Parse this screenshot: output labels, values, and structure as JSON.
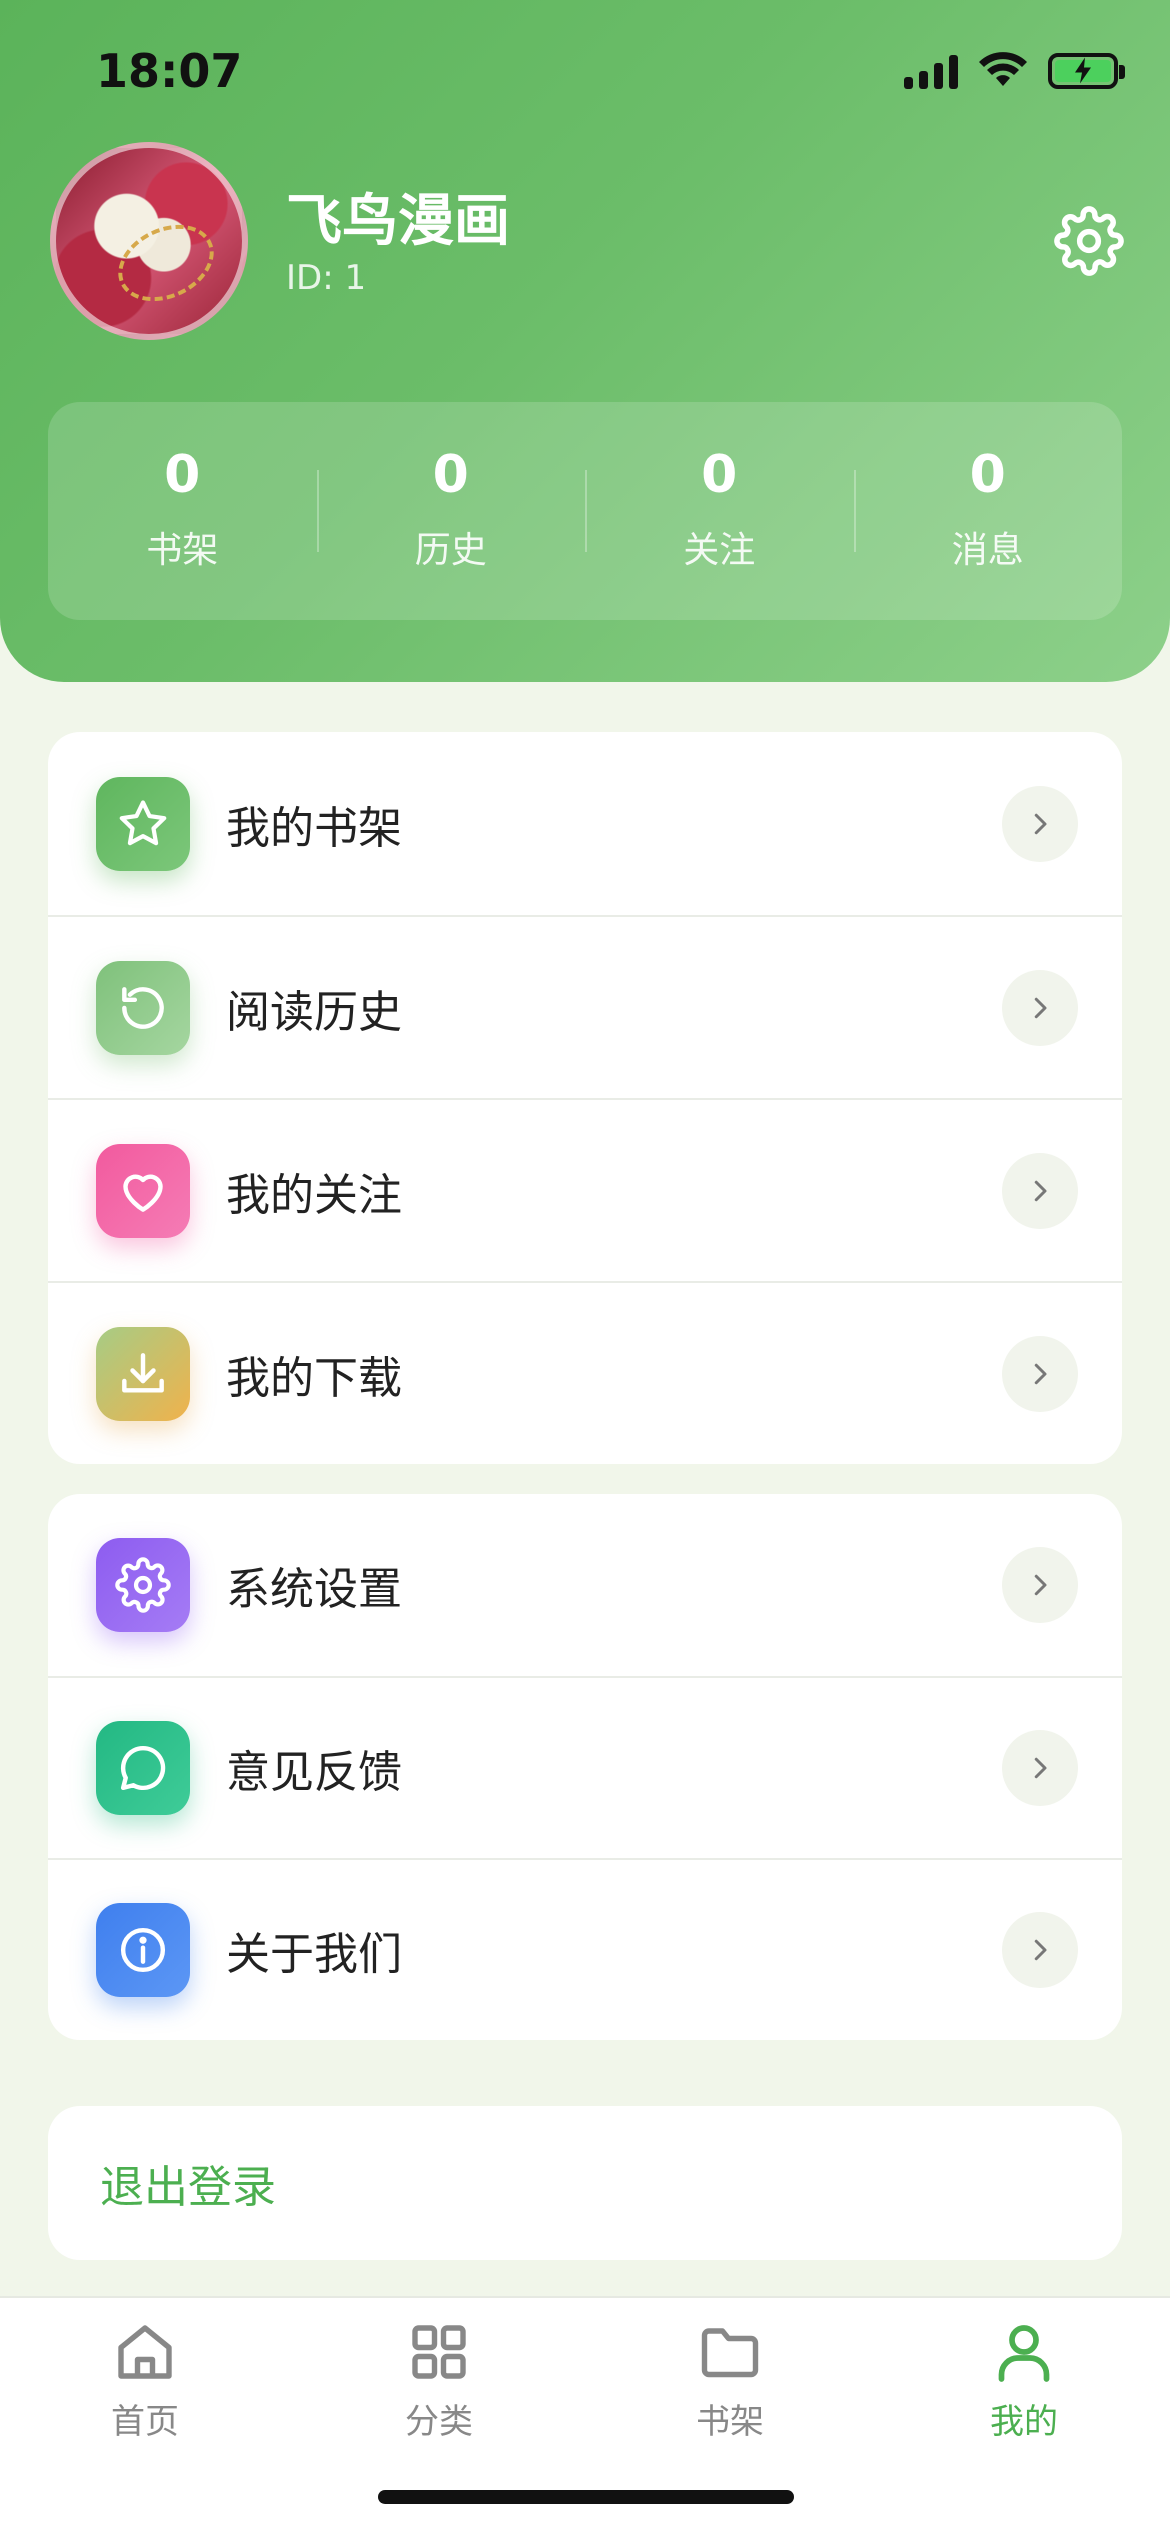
{
  "status_bar": {
    "time": "18:07"
  },
  "profile": {
    "name": "飞鸟漫画",
    "id_text": "ID: 1"
  },
  "stats": [
    {
      "value": "0",
      "label": "书架"
    },
    {
      "value": "0",
      "label": "历史"
    },
    {
      "value": "0",
      "label": "关注"
    },
    {
      "value": "0",
      "label": "消息"
    }
  ],
  "menu_group_1": [
    {
      "label": "我的书架",
      "icon": "star-icon",
      "color": "#5fb65e"
    },
    {
      "label": "阅读历史",
      "icon": "history-icon",
      "color": "#7fc17b"
    },
    {
      "label": "我的关注",
      "icon": "heart-icon",
      "color": "#f25a9e"
    },
    {
      "label": "我的下载",
      "icon": "download-icon",
      "color": "#f0b24c"
    }
  ],
  "menu_group_2": [
    {
      "label": "系统设置",
      "icon": "gear-icon",
      "color": "#8d5cf0"
    },
    {
      "label": "意见反馈",
      "icon": "chat-bubble-icon",
      "color": "#23b883"
    },
    {
      "label": "关于我们",
      "icon": "info-icon",
      "color": "#3f7fee"
    }
  ],
  "logout_label": "退出登录",
  "tabs": [
    {
      "label": "首页",
      "icon": "home-icon",
      "active": false
    },
    {
      "label": "分类",
      "icon": "grid-icon",
      "active": false
    },
    {
      "label": "书架",
      "icon": "folder-icon",
      "active": false
    },
    {
      "label": "我的",
      "icon": "user-icon",
      "active": true
    }
  ],
  "colors": {
    "accent": "#4caf50",
    "header_start": "#5bb35a",
    "header_end": "#8dd08a",
    "page_bg": "#f1f6ea"
  }
}
